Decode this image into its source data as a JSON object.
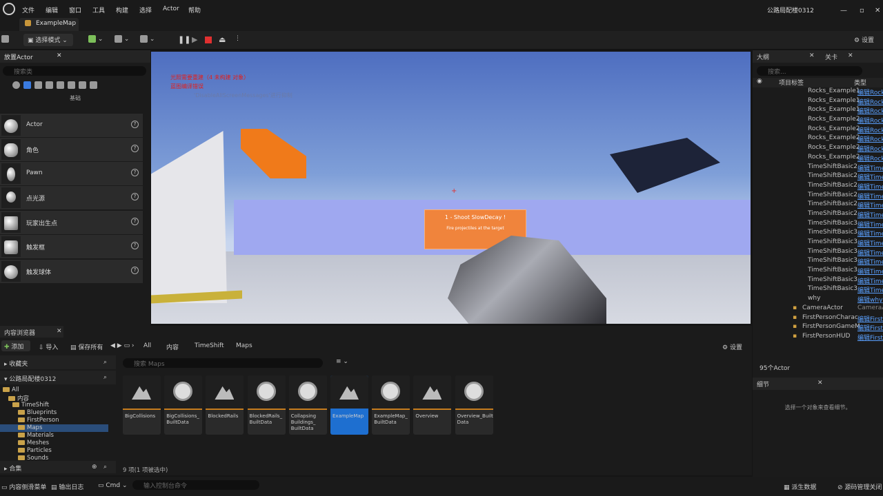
{
  "menu": [
    "文件",
    "编辑",
    "窗口",
    "工具",
    "构建",
    "选择",
    "Actor",
    "帮助"
  ],
  "project_name": "公路局配楼0312",
  "map_tab": "ExampleMap",
  "toolbar": {
    "select_mode": "选择模式",
    "settings": "设置"
  },
  "place_actors": {
    "title": "放置Actor",
    "search_placeholder": "搜索类",
    "category": "基础",
    "items": [
      "Actor",
      "角色",
      "Pawn",
      "点光源",
      "玩家出生点",
      "触发框",
      "触发球体"
    ]
  },
  "viewport": {
    "warning1": "光照需要重建（4 未构建 对象）",
    "warning2": "蓝图编译错误",
    "warning3": "'DisableAllScreenMessages'进行抑制",
    "target_text": "1 - Shoot SlowDecay !",
    "target_sub": "Fire projectiles at the target"
  },
  "outliner": {
    "tab1": "大纲",
    "tab2": "关卡",
    "search_placeholder": "搜索...",
    "col_label": "项目标签",
    "col_type": "类型",
    "rows": [
      [
        "Rocks_Example1",
        "编辑Rocks"
      ],
      [
        "Rocks_Example1",
        "编辑Rocks"
      ],
      [
        "Rocks_Example1",
        "编辑Rocks"
      ],
      [
        "Rocks_Example2",
        "编辑Rocks"
      ],
      [
        "Rocks_Example2",
        "编辑Rocks"
      ],
      [
        "Rocks_Example2",
        "编辑Rocks"
      ],
      [
        "Rocks_Example2",
        "编辑Rocks"
      ],
      [
        "Rocks_Example2",
        "编辑Rocks"
      ],
      [
        "TimeShiftBasic2",
        "编辑Time"
      ],
      [
        "TimeShiftBasic2",
        "编辑Time"
      ],
      [
        "TimeShiftBasic2",
        "编辑Time"
      ],
      [
        "TimeShiftBasic2",
        "编辑Time"
      ],
      [
        "TimeShiftBasic2",
        "编辑Time"
      ],
      [
        "TimeShiftBasic2",
        "编辑Time"
      ],
      [
        "TimeShiftBasic3",
        "编辑Time"
      ],
      [
        "TimeShiftBasic3",
        "编辑Time"
      ],
      [
        "TimeShiftBasic3",
        "编辑Time"
      ],
      [
        "TimeShiftBasic3",
        "编辑Time"
      ],
      [
        "TimeShiftBasic3",
        "编辑Time"
      ],
      [
        "TimeShiftBasic3",
        "编辑Time"
      ],
      [
        "TimeShiftBasic3",
        "编辑Time"
      ],
      [
        "TimeShiftBasic3",
        "编辑Time"
      ],
      [
        "why",
        "编辑why"
      ]
    ],
    "rows2": [
      [
        "CameraActor",
        "CameraAc"
      ],
      [
        "FirstPersonCharac",
        "编辑First"
      ],
      [
        "FirstPersonGameM",
        "编辑First"
      ],
      [
        "FirstPersonHUD",
        "编辑First"
      ]
    ],
    "count": "95个Actor"
  },
  "details": {
    "title": "细节",
    "hint": "选择一个对象来查看细节。"
  },
  "content": {
    "title": "内容浏览器",
    "add": "添加",
    "import": "导入",
    "save_all": "保存所有",
    "path": [
      "All",
      "内容",
      "TimeShift",
      "Maps"
    ],
    "settings": "设置",
    "favorites": "收藏夹",
    "project": "公路局配楼0312",
    "search_placeholder": "搜索 Maps",
    "collections": "合集",
    "summary": "9 项(1 项被选中)",
    "tree": [
      "All",
      "内容",
      "TimeShift",
      "Blueprints",
      "FirstPerson",
      "Maps",
      "Materials",
      "Meshes",
      "Particles",
      "Sounds"
    ],
    "assets": [
      "BigCollisions",
      "BigCollisions_ BuiltData",
      "BlockedRails",
      "BlockedRails_ BuiltData",
      "Collapsing Buildings_ BuiltData",
      "ExampleMap",
      "ExampleMap_ BuiltData",
      "Overview",
      "Overview_Built Data"
    ]
  },
  "status": {
    "drawer": "内容侧滑菜单",
    "log": "输出日志",
    "cmd": "Cmd",
    "cmd_placeholder": "输入控制台命令",
    "derived": "派生数据",
    "source": "源码管理关闭"
  }
}
